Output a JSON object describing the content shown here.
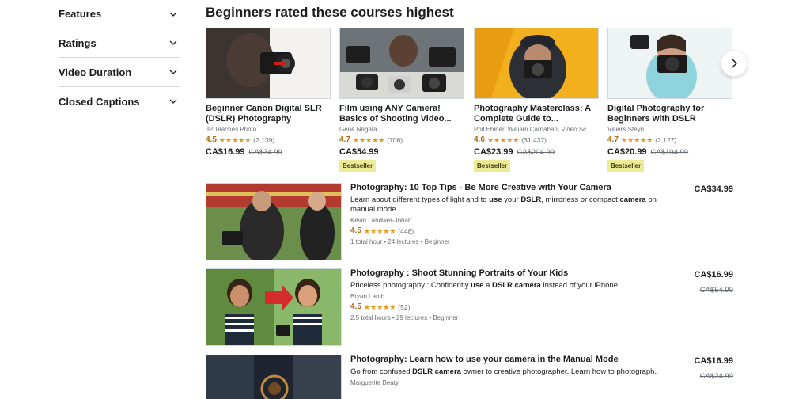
{
  "filters": [
    {
      "label": "Features"
    },
    {
      "label": "Ratings"
    },
    {
      "label": "Video Duration"
    },
    {
      "label": "Closed Captions"
    }
  ],
  "section_title": "Beginners rated these courses highest",
  "cards": [
    {
      "title": "Beginner Canon Digital SLR (DSLR) Photography",
      "author": "JP Teaches Photo .",
      "rating": "4.5",
      "reviews": "(2,139)",
      "price": "CA$16.99",
      "old_price": "CA$34.99",
      "badge": "",
      "star_fill": 4.5
    },
    {
      "title": "Film using ANY Camera! Basics of Shooting Video...",
      "author": "Gene Nagata",
      "rating": "4.7",
      "reviews": "(706)",
      "price": "CA$54.99",
      "old_price": "",
      "badge": "Bestseller",
      "star_fill": 4.7
    },
    {
      "title": "Photography Masterclass: A Complete Guide to...",
      "author": "Phil Ebiner, William Carnahan, Video Sc...",
      "rating": "4.6",
      "reviews": "(31,437)",
      "price": "CA$23.99",
      "old_price": "CA$204.99",
      "badge": "Bestseller",
      "star_fill": 4.6
    },
    {
      "title": "Digital Photography for Beginners with DSLR cameras",
      "author": "Villiers Steyn",
      "rating": "4.7",
      "reviews": "(2,127)",
      "price": "CA$20.99",
      "old_price": "CA$104.99",
      "badge": "Bestseller",
      "star_fill": 4.7
    }
  ],
  "list": [
    {
      "title": "Photography: 10 Top Tips - Be More Creative with Your Camera",
      "desc_parts": [
        "Learn about different types of light and to ",
        "use",
        " your ",
        "DSLR",
        ", mirrorless or compact ",
        "camera",
        " on manual mode"
      ],
      "author": "Kevin Landwer-Johan",
      "rating": "4.5",
      "reviews": "(448)",
      "meta": "1 total hour • 24 lectures • Beginner",
      "price": "CA$34.99",
      "old_price": ""
    },
    {
      "title": "Photography : Shoot Stunning Portraits of Your Kids",
      "desc_parts": [
        "Priceless photography : Confidently ",
        "use",
        " a ",
        "DSLR camera",
        " instead of your iPhone"
      ],
      "author": "Bryan Lamb",
      "rating": "4.5",
      "reviews": "(52)",
      "meta": "2.5 total hours • 29 lectures • Beginner",
      "price": "CA$16.99",
      "old_price": "CA$54.99"
    },
    {
      "title": "Photography: Learn how to use your camera in the Manual Mode",
      "desc_parts": [
        "Go from confused ",
        "DSLR camera",
        " owner to creative photographer. Learn how to photograph."
      ],
      "author": "Marguerite Beaty",
      "rating": "",
      "reviews": "",
      "meta": "",
      "price": "CA$16.99",
      "old_price": "CA$24.99"
    }
  ],
  "colors": {
    "rating": "#b4690e",
    "star": "#e59819",
    "badge_bg": "#eceb98",
    "badge_text": "#3d3c0a"
  }
}
